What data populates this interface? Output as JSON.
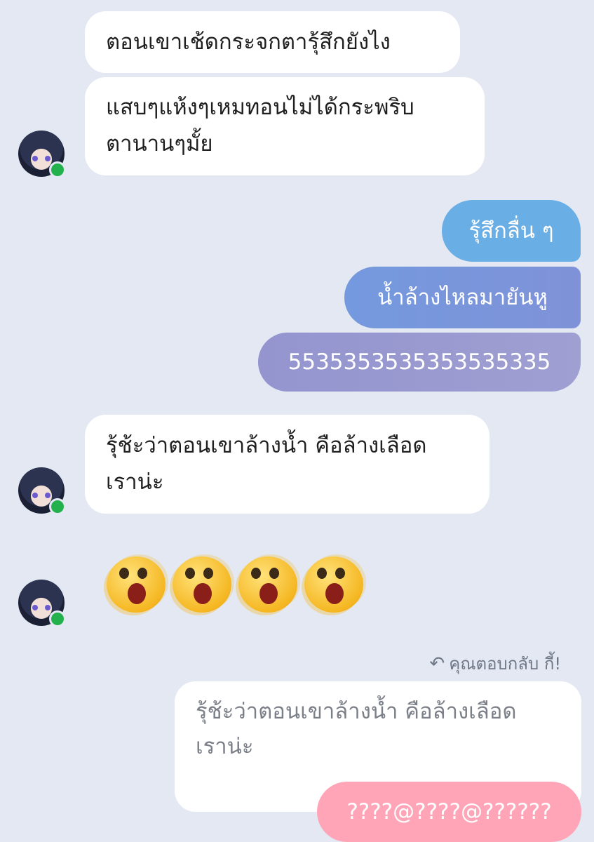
{
  "conversation": {
    "incoming_1": {
      "line_1": "ตอนเขาเช้ดกระจกตารุ้สึกยังไง",
      "line_2a": "แสบๆแห้งๆเหมทอนไม่ได้กระพริบ",
      "line_2b": "ตานานๆมั้ย"
    },
    "outgoing_1": {
      "msg_1": "รุ้สึกลื่น ๆ",
      "msg_2": "น้ำล้างไหลมายันหู",
      "msg_3": "5535353535353535335"
    },
    "incoming_2": {
      "line_a": "รุ้ช้ะว่าตอนเขาล้างน้ำ คือล้างเลือด",
      "line_b": "เราน่ะ"
    },
    "emoji_reaction": [
      "surprised-face",
      "surprised-face",
      "surprised-face",
      "surprised-face"
    ],
    "reply": {
      "note": "คุณตอบกลับ กี้!",
      "quoted_a": "รุ้ช้ะว่าตอนเขาล้างน้ำ คือล้างเลือด",
      "quoted_b": "เราน่ะ",
      "message": "????@????@??????"
    }
  },
  "colors": {
    "background": "#e3e8f2",
    "outgoing_gradient": [
      "#6aaee6",
      "#7a8fd9",
      "#9b94cf"
    ],
    "reply_accent": "#ffa5b7",
    "online_status": "#22b14c"
  }
}
